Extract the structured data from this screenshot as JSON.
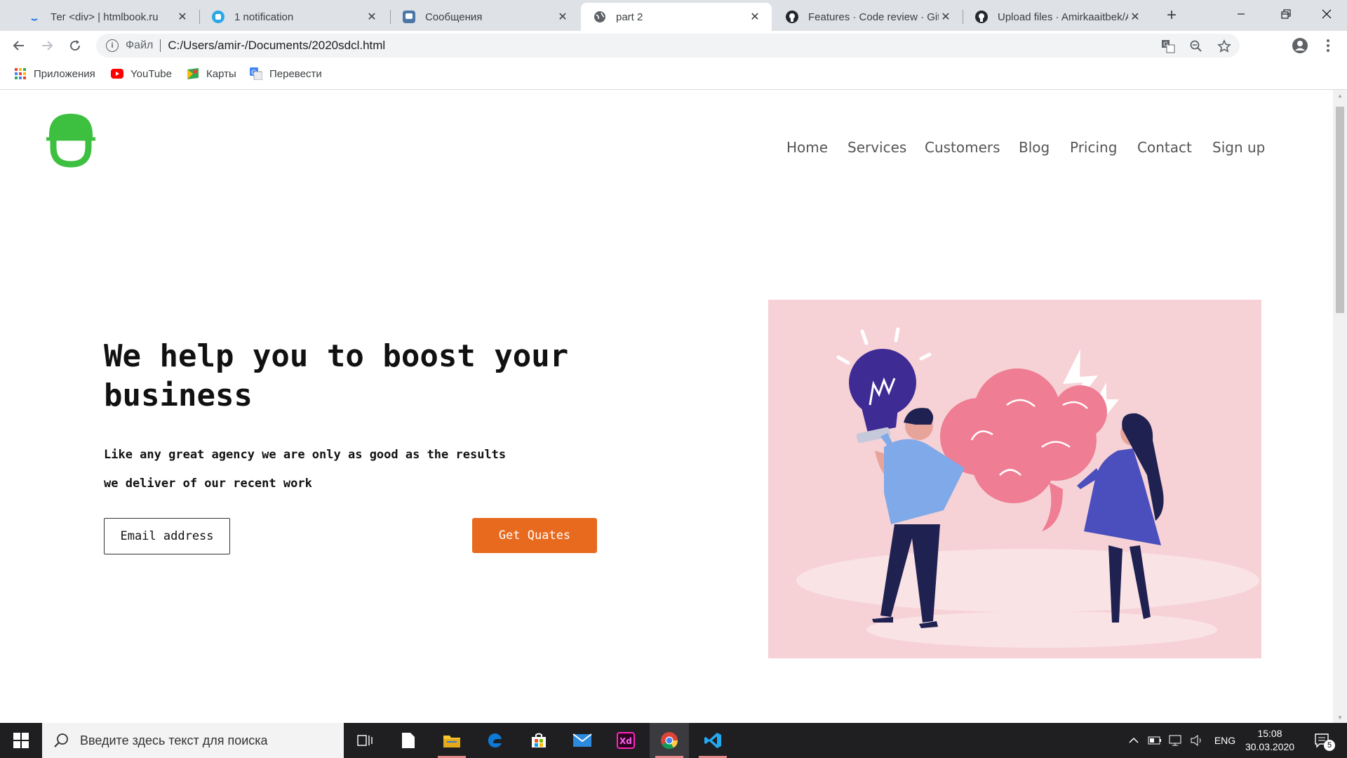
{
  "browser": {
    "tabs": [
      {
        "title": "Тег <div> | htmlbook.ru",
        "icon": "htmlbook-icon"
      },
      {
        "title": "1 notification",
        "icon": "notification-app-icon"
      },
      {
        "title": "Сообщения",
        "icon": "vk-messages-icon"
      },
      {
        "title": "part 2",
        "icon": "globe-icon",
        "active": true
      },
      {
        "title": "Features · Code review · GitHub",
        "icon": "github-icon"
      },
      {
        "title": "Upload files · Amirkaaitbek/A",
        "icon": "github-icon"
      }
    ],
    "omnibox": {
      "scheme_label": "Файл",
      "url": "C:/Users/amir-/Documents/2020sdcl.html"
    },
    "bookmarks": [
      {
        "label": "Приложения",
        "icon": "apps-grid-icon"
      },
      {
        "label": "YouTube",
        "icon": "youtube-icon"
      },
      {
        "label": "Карты",
        "icon": "maps-icon"
      },
      {
        "label": "Перевести",
        "icon": "translate-icon"
      }
    ]
  },
  "page": {
    "nav": [
      "Home",
      "Services",
      "Customers",
      "Blog",
      "Pricing",
      "Contact",
      "Sign up"
    ],
    "hero": {
      "title": "We help you to boost your business",
      "subtitle_line1": "Like any great agency we are only as good as the results",
      "subtitle_line2": "we deliver of our recent work",
      "email_button": "Email address",
      "cta_button": "Get Quates"
    },
    "colors": {
      "logo_green": "#3dbf3f",
      "cta_orange": "#e86a1e",
      "art_background": "#f6d2d6"
    }
  },
  "taskbar": {
    "search_placeholder": "Введите здесь текст для поиска",
    "language": "ENG",
    "time": "15:08",
    "date": "30.03.2020",
    "notification_count": "5"
  }
}
